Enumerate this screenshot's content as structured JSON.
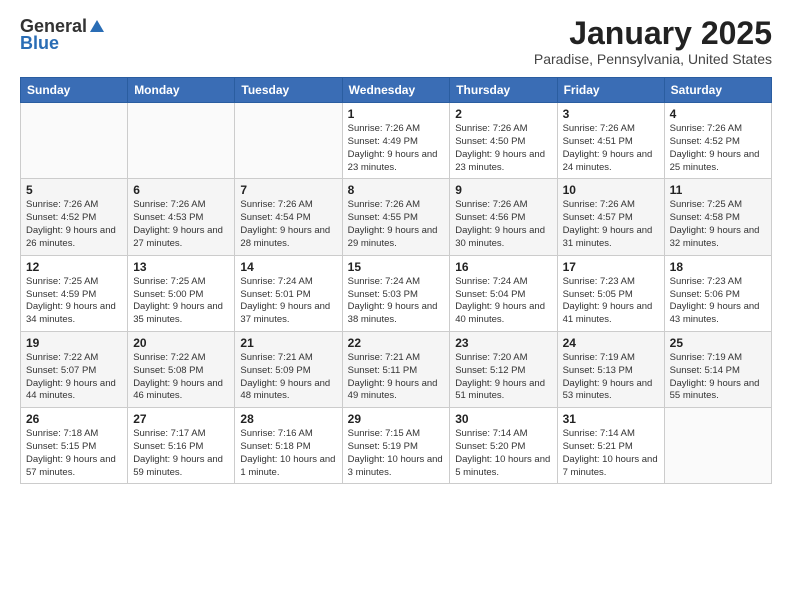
{
  "header": {
    "logo_general": "General",
    "logo_blue": "Blue",
    "month_title": "January 2025",
    "location": "Paradise, Pennsylvania, United States"
  },
  "weekdays": [
    "Sunday",
    "Monday",
    "Tuesday",
    "Wednesday",
    "Thursday",
    "Friday",
    "Saturday"
  ],
  "weeks": [
    [
      {
        "day": "",
        "info": ""
      },
      {
        "day": "",
        "info": ""
      },
      {
        "day": "",
        "info": ""
      },
      {
        "day": "1",
        "info": "Sunrise: 7:26 AM\nSunset: 4:49 PM\nDaylight: 9 hours and 23 minutes."
      },
      {
        "day": "2",
        "info": "Sunrise: 7:26 AM\nSunset: 4:50 PM\nDaylight: 9 hours and 23 minutes."
      },
      {
        "day": "3",
        "info": "Sunrise: 7:26 AM\nSunset: 4:51 PM\nDaylight: 9 hours and 24 minutes."
      },
      {
        "day": "4",
        "info": "Sunrise: 7:26 AM\nSunset: 4:52 PM\nDaylight: 9 hours and 25 minutes."
      }
    ],
    [
      {
        "day": "5",
        "info": "Sunrise: 7:26 AM\nSunset: 4:52 PM\nDaylight: 9 hours and 26 minutes."
      },
      {
        "day": "6",
        "info": "Sunrise: 7:26 AM\nSunset: 4:53 PM\nDaylight: 9 hours and 27 minutes."
      },
      {
        "day": "7",
        "info": "Sunrise: 7:26 AM\nSunset: 4:54 PM\nDaylight: 9 hours and 28 minutes."
      },
      {
        "day": "8",
        "info": "Sunrise: 7:26 AM\nSunset: 4:55 PM\nDaylight: 9 hours and 29 minutes."
      },
      {
        "day": "9",
        "info": "Sunrise: 7:26 AM\nSunset: 4:56 PM\nDaylight: 9 hours and 30 minutes."
      },
      {
        "day": "10",
        "info": "Sunrise: 7:26 AM\nSunset: 4:57 PM\nDaylight: 9 hours and 31 minutes."
      },
      {
        "day": "11",
        "info": "Sunrise: 7:25 AM\nSunset: 4:58 PM\nDaylight: 9 hours and 32 minutes."
      }
    ],
    [
      {
        "day": "12",
        "info": "Sunrise: 7:25 AM\nSunset: 4:59 PM\nDaylight: 9 hours and 34 minutes."
      },
      {
        "day": "13",
        "info": "Sunrise: 7:25 AM\nSunset: 5:00 PM\nDaylight: 9 hours and 35 minutes."
      },
      {
        "day": "14",
        "info": "Sunrise: 7:24 AM\nSunset: 5:01 PM\nDaylight: 9 hours and 37 minutes."
      },
      {
        "day": "15",
        "info": "Sunrise: 7:24 AM\nSunset: 5:03 PM\nDaylight: 9 hours and 38 minutes."
      },
      {
        "day": "16",
        "info": "Sunrise: 7:24 AM\nSunset: 5:04 PM\nDaylight: 9 hours and 40 minutes."
      },
      {
        "day": "17",
        "info": "Sunrise: 7:23 AM\nSunset: 5:05 PM\nDaylight: 9 hours and 41 minutes."
      },
      {
        "day": "18",
        "info": "Sunrise: 7:23 AM\nSunset: 5:06 PM\nDaylight: 9 hours and 43 minutes."
      }
    ],
    [
      {
        "day": "19",
        "info": "Sunrise: 7:22 AM\nSunset: 5:07 PM\nDaylight: 9 hours and 44 minutes."
      },
      {
        "day": "20",
        "info": "Sunrise: 7:22 AM\nSunset: 5:08 PM\nDaylight: 9 hours and 46 minutes."
      },
      {
        "day": "21",
        "info": "Sunrise: 7:21 AM\nSunset: 5:09 PM\nDaylight: 9 hours and 48 minutes."
      },
      {
        "day": "22",
        "info": "Sunrise: 7:21 AM\nSunset: 5:11 PM\nDaylight: 9 hours and 49 minutes."
      },
      {
        "day": "23",
        "info": "Sunrise: 7:20 AM\nSunset: 5:12 PM\nDaylight: 9 hours and 51 minutes."
      },
      {
        "day": "24",
        "info": "Sunrise: 7:19 AM\nSunset: 5:13 PM\nDaylight: 9 hours and 53 minutes."
      },
      {
        "day": "25",
        "info": "Sunrise: 7:19 AM\nSunset: 5:14 PM\nDaylight: 9 hours and 55 minutes."
      }
    ],
    [
      {
        "day": "26",
        "info": "Sunrise: 7:18 AM\nSunset: 5:15 PM\nDaylight: 9 hours and 57 minutes."
      },
      {
        "day": "27",
        "info": "Sunrise: 7:17 AM\nSunset: 5:16 PM\nDaylight: 9 hours and 59 minutes."
      },
      {
        "day": "28",
        "info": "Sunrise: 7:16 AM\nSunset: 5:18 PM\nDaylight: 10 hours and 1 minute."
      },
      {
        "day": "29",
        "info": "Sunrise: 7:15 AM\nSunset: 5:19 PM\nDaylight: 10 hours and 3 minutes."
      },
      {
        "day": "30",
        "info": "Sunrise: 7:14 AM\nSunset: 5:20 PM\nDaylight: 10 hours and 5 minutes."
      },
      {
        "day": "31",
        "info": "Sunrise: 7:14 AM\nSunset: 5:21 PM\nDaylight: 10 hours and 7 minutes."
      },
      {
        "day": "",
        "info": ""
      }
    ]
  ]
}
